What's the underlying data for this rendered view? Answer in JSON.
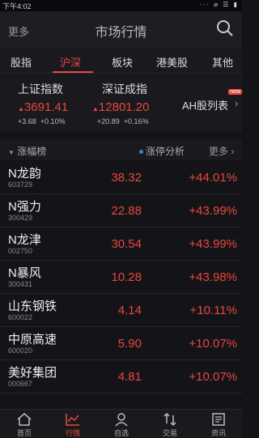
{
  "status_bar": {
    "time": "下午4:02",
    "icons_text": "··· ⌀ ☰ ▮"
  },
  "header": {
    "more": "更多",
    "title": "市场行情"
  },
  "tabs": [
    "股指",
    "沪深",
    "板块",
    "港美股",
    "其他"
  ],
  "active_tab": 1,
  "indices": [
    {
      "name": "上证指数",
      "value": "3691.41",
      "change": "+3.68",
      "pct": "+0.10%"
    },
    {
      "name": "深证成指",
      "value": "12801.20",
      "change": "+20.89",
      "pct": "+0.16%"
    }
  ],
  "ah_link": "AH股列表",
  "ah_badge": "new",
  "list_header": {
    "left": "涨幅榜",
    "middle": "涨停分析",
    "right": "更多"
  },
  "stocks": [
    {
      "name": "N龙韵",
      "code": "603729",
      "price": "38.32",
      "pct": "+44.01%"
    },
    {
      "name": "N强力",
      "code": "300429",
      "price": "22.88",
      "pct": "+43.99%"
    },
    {
      "name": "N龙津",
      "code": "002750",
      "price": "30.54",
      "pct": "+43.99%"
    },
    {
      "name": "N暴风",
      "code": "300431",
      "price": "10.28",
      "pct": "+43.98%"
    },
    {
      "name": "山东钢铁",
      "code": "600022",
      "price": "4.14",
      "pct": "+10.11%"
    },
    {
      "name": "中原高速",
      "code": "600020",
      "price": "5.90",
      "pct": "+10.07%"
    },
    {
      "name": "美好集团",
      "code": "000667",
      "price": "4.81",
      "pct": "+10.07%"
    }
  ],
  "bottom_nav": [
    {
      "label": "首页",
      "icon": "home-icon"
    },
    {
      "label": "行情",
      "icon": "chart-icon"
    },
    {
      "label": "自选",
      "icon": "user-icon"
    },
    {
      "label": "交易",
      "icon": "trade-icon"
    },
    {
      "label": "资讯",
      "icon": "news-icon"
    }
  ],
  "colors": {
    "accent": "#e8473c",
    "background": "#141418",
    "blue": "#2a8ad4"
  }
}
